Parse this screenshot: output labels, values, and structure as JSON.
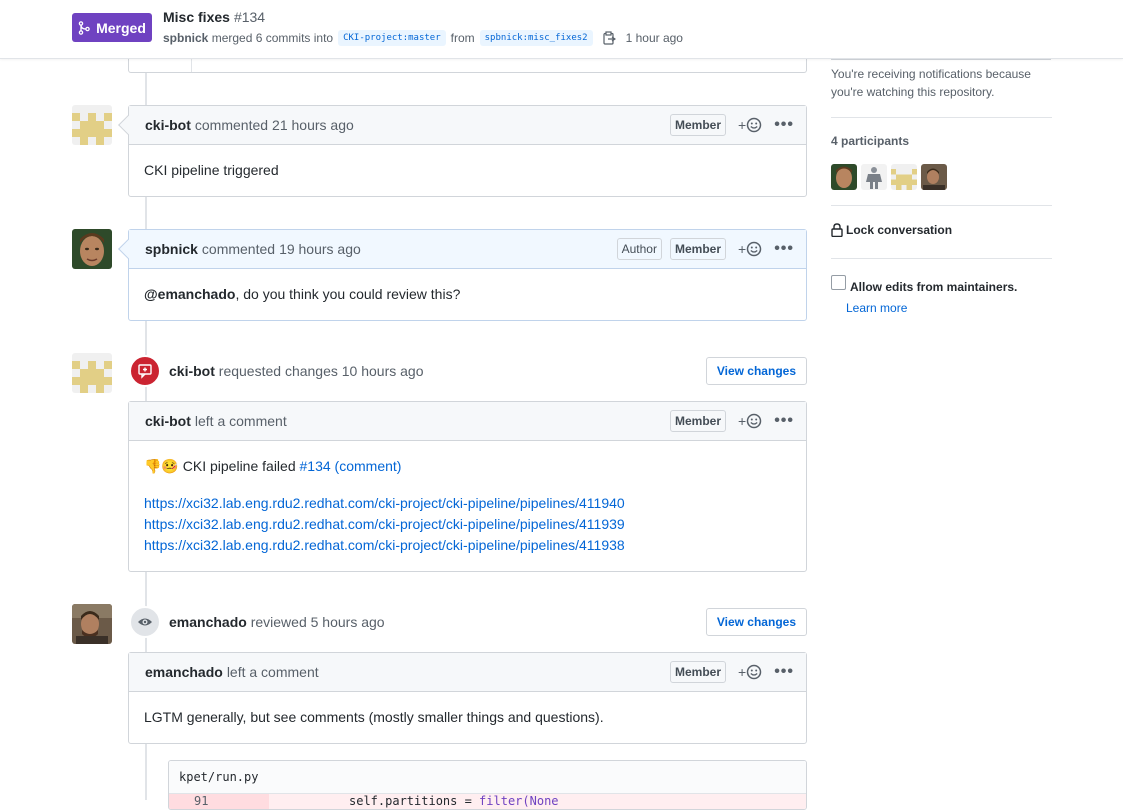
{
  "header": {
    "state": "Merged",
    "title": "Misc fixes",
    "number": "#134",
    "author": "spbnick",
    "merge_text": "merged 6 commits into",
    "base_branch": "CKI-project:master",
    "from_text": "from",
    "head_branch": "spbnick:misc_fixes2",
    "time": "1 hour ago",
    "state_color": "#6f42c1"
  },
  "timeline": {
    "c1": {
      "author": "cki-bot",
      "action": "commented",
      "time": "21 hours ago",
      "role": "Member",
      "body": "CKI pipeline triggered"
    },
    "c2": {
      "author": "spbnick",
      "action": "commented",
      "time": "19 hours ago",
      "badge_author": "Author",
      "role": "Member",
      "mention": "@emanchado",
      "body": ", do you think you could review this?"
    },
    "e1": {
      "author": "cki-bot",
      "action": "requested changes",
      "time": "10 hours ago",
      "button": "View changes"
    },
    "c3": {
      "author": "cki-bot",
      "action": "left a comment",
      "role": "Member",
      "emoji": "👎🤒",
      "text": " CKI pipeline failed ",
      "link": "#134 (comment)",
      "links": [
        "https://xci32.lab.eng.rdu2.redhat.com/cki-project/cki-pipeline/pipelines/411940",
        "https://xci32.lab.eng.rdu2.redhat.com/cki-project/cki-pipeline/pipelines/411939",
        "https://xci32.lab.eng.rdu2.redhat.com/cki-project/cki-pipeline/pipelines/411938"
      ]
    },
    "e2": {
      "author": "emanchado",
      "action": "reviewed",
      "time": "5 hours ago",
      "button": "View changes"
    },
    "c4": {
      "author": "emanchado",
      "action": "left a comment",
      "role": "Member",
      "body": "LGTM generally, but see comments (mostly smaller things and questions)."
    },
    "file": {
      "path": "kpet/run.py",
      "line_num": "91",
      "code_a": "self.partitions = ",
      "code_fn": "filter(None"
    }
  },
  "sidebar": {
    "notify_text": "You're receiving notifications because you're watching this repository.",
    "participants_label": "4 participants",
    "lock_label": "Lock conversation",
    "allow_edits_label": "Allow edits from maintainers.",
    "learn_more": "Learn more"
  }
}
